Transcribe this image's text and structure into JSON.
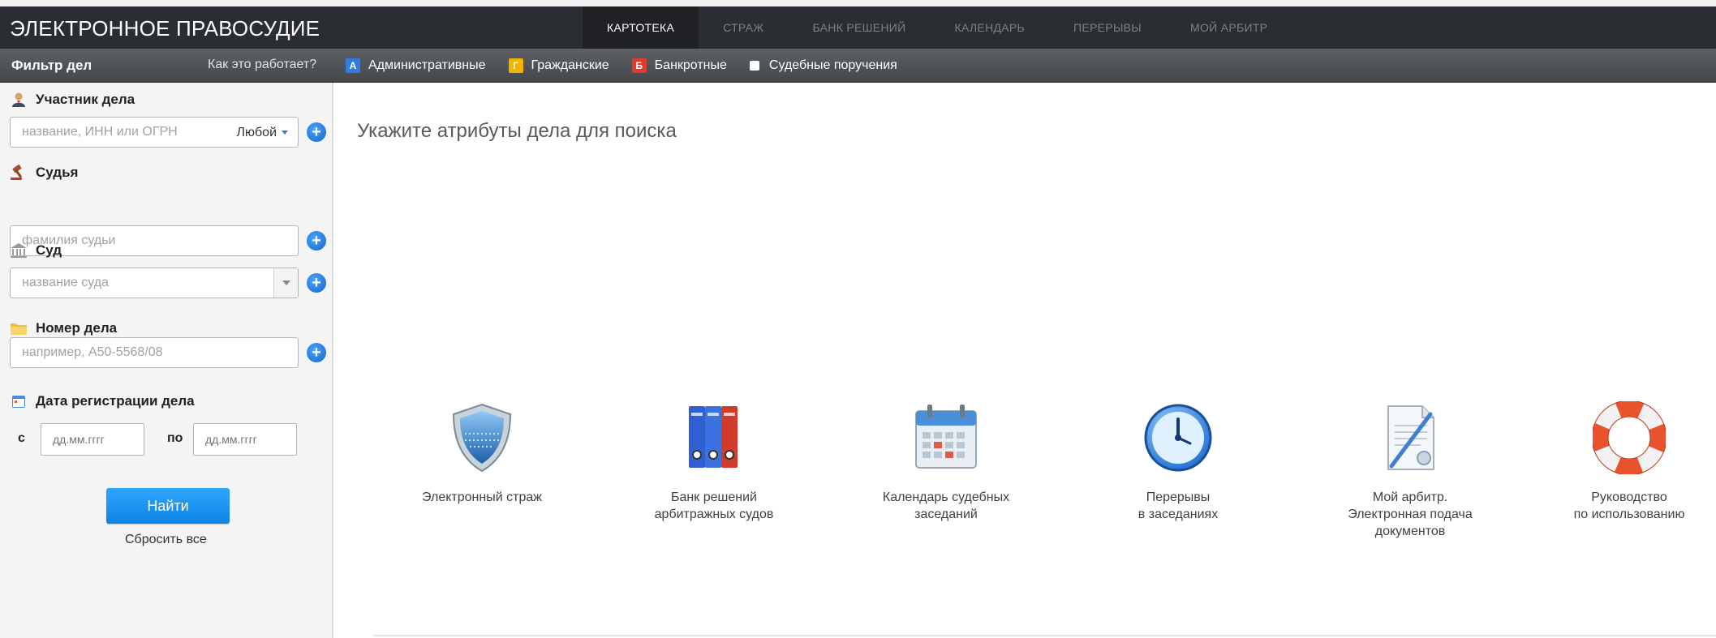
{
  "header": {
    "brand": "ЭЛЕКТРОННОЕ ПРАВОСУДИЕ",
    "nav": [
      "КАРТОТЕКА",
      "СТРАЖ",
      "БАНК РЕШЕНИЙ",
      "КАЛЕНДАРЬ",
      "ПЕРЕРЫВЫ",
      "МОЙ АРБИТР"
    ],
    "active_nav": "КАРТОТЕКА"
  },
  "subbar": {
    "filter_title": "Фильтр дел",
    "how_link": "Как это работает?",
    "categories": [
      {
        "letter": "А",
        "label": "Административные",
        "color": "#2f7de1"
      },
      {
        "letter": "Г",
        "label": "Гражданские",
        "color": "#f0b300"
      },
      {
        "letter": "Б",
        "label": "Банкротные",
        "color": "#e13a2f"
      }
    ],
    "orders_label": "Судебные поручения"
  },
  "sidebar": {
    "participant": {
      "label": "Участник дела",
      "placeholder": "название, ИНН или ОГРН",
      "selector": "Любой"
    },
    "judge": {
      "label": "Судья",
      "placeholder": "фамилия судьи"
    },
    "court": {
      "label": "Суд",
      "placeholder": "название суда"
    },
    "case_number": {
      "label": "Номер дела",
      "placeholder": "например, А50-5568/08"
    },
    "reg_date": {
      "label": "Дата регистрации дела",
      "from_label": "с",
      "to_label": "по",
      "from_placeholder": "дд.мм.гггг",
      "to_placeholder": "дд.мм.гггг"
    },
    "find_button": "Найти",
    "reset_link": "Сбросить все"
  },
  "main": {
    "title": "Укажите атрибуты дела для поиска",
    "tiles": [
      {
        "icon": "shield-icon",
        "label": "Электронный страж"
      },
      {
        "icon": "folders-icon",
        "label": "Банк решений\nарбитражных судов"
      },
      {
        "icon": "calendar-icon",
        "label": "Календарь судебных\nзаседаний"
      },
      {
        "icon": "clock-icon",
        "label": "Перерывы\nв заседаниях"
      },
      {
        "icon": "document-pen-icon",
        "label": "Мой арбитр.\nЭлектронная подача\nдокументов"
      },
      {
        "icon": "lifebuoy-icon",
        "label": "Руководство\nпо использованию"
      }
    ]
  }
}
